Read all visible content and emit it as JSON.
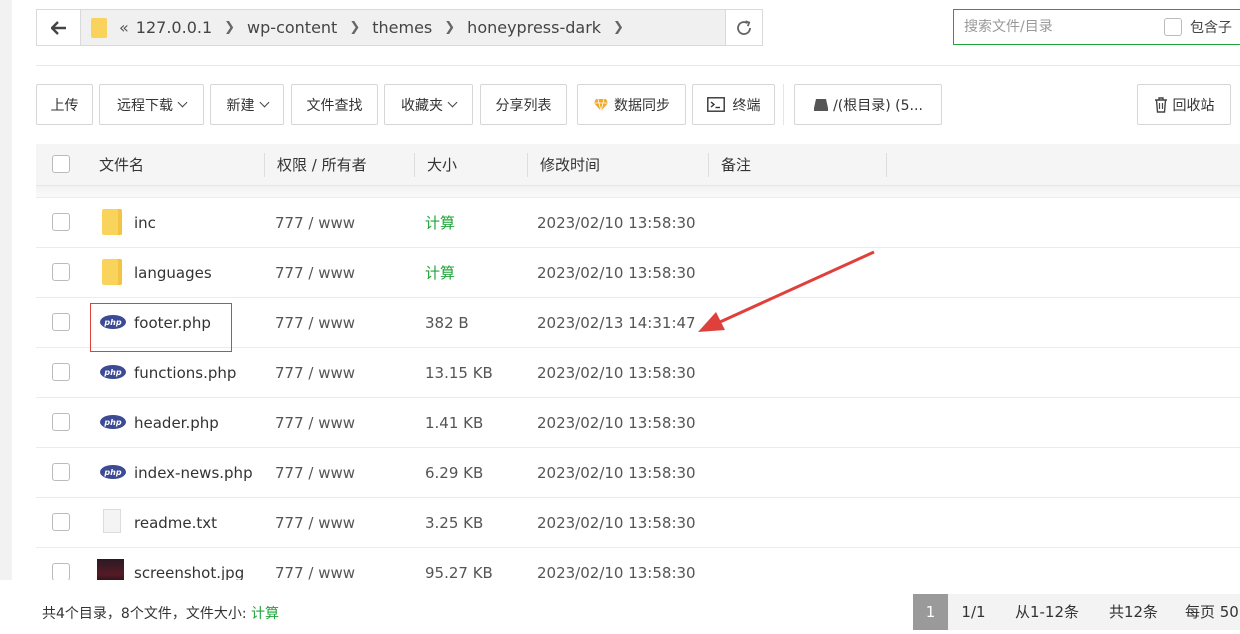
{
  "path": {
    "crumbs": [
      "127.0.0.1",
      "wp-content",
      "themes",
      "honeypress-dark"
    ],
    "overflow_glyph": "«"
  },
  "search": {
    "placeholder": "搜索文件/目录",
    "include_sub_label": "包含子"
  },
  "toolbar": {
    "upload": "上传",
    "remote_download": "远程下载",
    "new": "新建",
    "file_search": "文件查找",
    "favorites": "收藏夹",
    "share_list": "分享列表",
    "data_sync": "数据同步",
    "terminal": "终端",
    "disk": "/(根目录) (5...",
    "recycle": "回收站"
  },
  "table": {
    "headers": {
      "name": "文件名",
      "perm": "权限 / 所有者",
      "size": "大小",
      "mtime": "修改时间",
      "note": "备注"
    },
    "rows": [
      {
        "type": "folder",
        "name": "inc",
        "perm": "777 / www",
        "size": "计算",
        "mtime": "2023/02/10 13:58:30"
      },
      {
        "type": "folder",
        "name": "languages",
        "perm": "777 / www",
        "size": "计算",
        "mtime": "2023/02/10 13:58:30"
      },
      {
        "type": "php",
        "name": "footer.php",
        "perm": "777 / www",
        "size": "382 B",
        "mtime": "2023/02/13 14:31:47"
      },
      {
        "type": "php",
        "name": "functions.php",
        "perm": "777 / www",
        "size": "13.15 KB",
        "mtime": "2023/02/10 13:58:30"
      },
      {
        "type": "php",
        "name": "header.php",
        "perm": "777 / www",
        "size": "1.41 KB",
        "mtime": "2023/02/10 13:58:30"
      },
      {
        "type": "php",
        "name": "index-news.php",
        "perm": "777 / www",
        "size": "6.29 KB",
        "mtime": "2023/02/10 13:58:30"
      },
      {
        "type": "txt",
        "name": "readme.txt",
        "perm": "777 / www",
        "size": "3.25 KB",
        "mtime": "2023/02/10 13:58:30"
      },
      {
        "type": "image",
        "name": "screenshot.jpg",
        "perm": "777 / www",
        "size": "95.27 KB",
        "mtime": "2023/02/10 13:58:30"
      }
    ]
  },
  "icons": {
    "php_text": "php"
  },
  "footer": {
    "summary_prefix": "共4个目录，8个文件，文件大小: ",
    "summary_calc": "计算",
    "current_page": "1",
    "page_of": "1/1",
    "range": "从1-12条",
    "total": "共12条",
    "per_page": "每页 50"
  },
  "colors": {
    "accent_green": "#20a53a",
    "annotation_red": "#e0403c",
    "php_blue": "#3c4b93",
    "folder_yellow": "#f9d35c"
  }
}
